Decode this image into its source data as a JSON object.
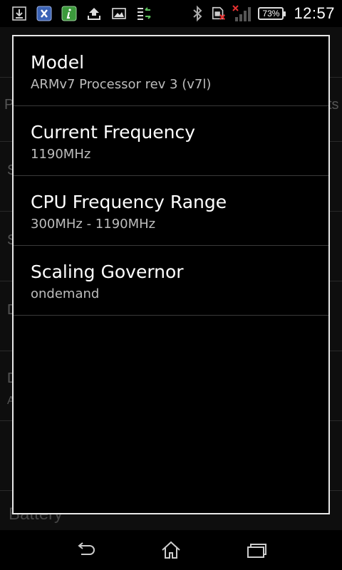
{
  "status_bar": {
    "left_icons": [
      "download-icon",
      "app-x-icon",
      "app-info-icon",
      "upload-icon",
      "image-icon",
      "data-transfer-icon"
    ],
    "right_icons": [
      "bluetooth-icon",
      "sim-error-icon",
      "no-signal-icon"
    ],
    "battery_percent": "73%",
    "time": "12:57"
  },
  "background_app": {
    "partial_texts": [
      "P",
      "ts",
      "S",
      "S",
      "D",
      "D",
      "A",
      "Battery"
    ]
  },
  "dialog": {
    "items": [
      {
        "title": "Model",
        "value": "ARMv7 Processor rev 3 (v7l)"
      },
      {
        "title": "Current Frequency",
        "value": "1190MHz"
      },
      {
        "title": "CPU Frequency Range",
        "value": "300MHz - 1190MHz"
      },
      {
        "title": "Scaling Governor",
        "value": "ondemand"
      }
    ]
  },
  "nav_bar": {
    "buttons": [
      "back-icon",
      "home-icon",
      "recent-apps-icon"
    ]
  },
  "colors": {
    "background": "#000000",
    "dialog_border": "#e8e8e8",
    "title_text": "#ffffff",
    "value_text": "#bdbdbd",
    "divider": "#3a3a3a",
    "app_icon_blue": "#3b63b6",
    "app_icon_green": "#3c9a3c",
    "error_red": "#e53030"
  }
}
